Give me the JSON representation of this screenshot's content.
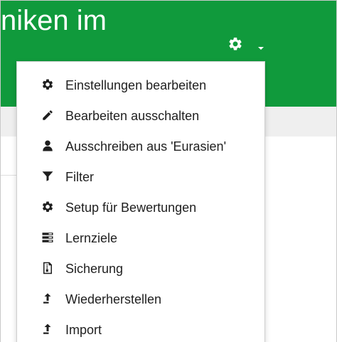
{
  "header": {
    "title": "niken im",
    "background_color": "#109a3c",
    "settings_icon": "gear-icon",
    "settings_caret_icon": "caret-down-icon"
  },
  "colors": {
    "accent": "#109a3c",
    "band": "#efefef",
    "text": "#1f1f1f"
  },
  "menu": {
    "items": [
      {
        "icon": "gear-icon",
        "label": "Einstellungen bearbeiten"
      },
      {
        "icon": "pencil-icon",
        "label": "Bearbeiten ausschalten"
      },
      {
        "icon": "user-icon",
        "label": "Ausschreiben aus 'Eurasien'"
      },
      {
        "icon": "filter-icon",
        "label": "Filter"
      },
      {
        "icon": "gear-icon",
        "label": "Setup für Bewertungen"
      },
      {
        "icon": "list-icon",
        "label": "Lernziele"
      },
      {
        "icon": "backup-file-icon",
        "label": "Sicherung"
      },
      {
        "icon": "upload-icon",
        "label": "Wiederherstellen"
      },
      {
        "icon": "upload-icon",
        "label": "Import"
      }
    ]
  }
}
